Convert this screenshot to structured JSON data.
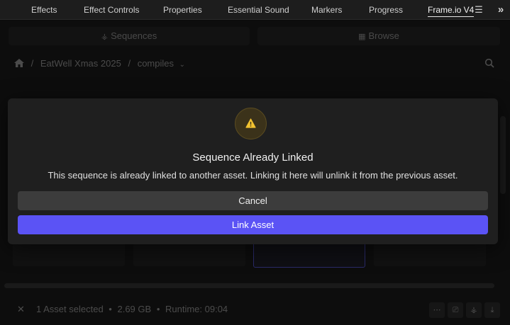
{
  "tabs": [
    {
      "label": "Effects",
      "active": false
    },
    {
      "label": "Effect Controls",
      "active": false
    },
    {
      "label": "Properties",
      "active": false
    },
    {
      "label": "Essential Sound",
      "active": false
    },
    {
      "label": "Markers",
      "active": false
    },
    {
      "label": "Progress",
      "active": false
    },
    {
      "label": "Frame.io V4",
      "active": true
    }
  ],
  "segments": {
    "sequences": "Sequences",
    "browse": "Browse"
  },
  "breadcrumb": {
    "project": "EatWell Xmas 2025",
    "separator": "/",
    "folder": "compiles"
  },
  "footer": {
    "selection": "1 Asset selected",
    "size": "2.69 GB",
    "runtime": "Runtime: 09:04",
    "dot": "•"
  },
  "dialog": {
    "title": "Sequence Already Linked",
    "message": "This sequence is already linked to another asset. Linking it here will unlink it from the previous asset.",
    "cancel_label": "Cancel",
    "confirm_label": "Link Asset"
  },
  "colors": {
    "accent": "#5b53f5",
    "warning": "#f2c230"
  }
}
